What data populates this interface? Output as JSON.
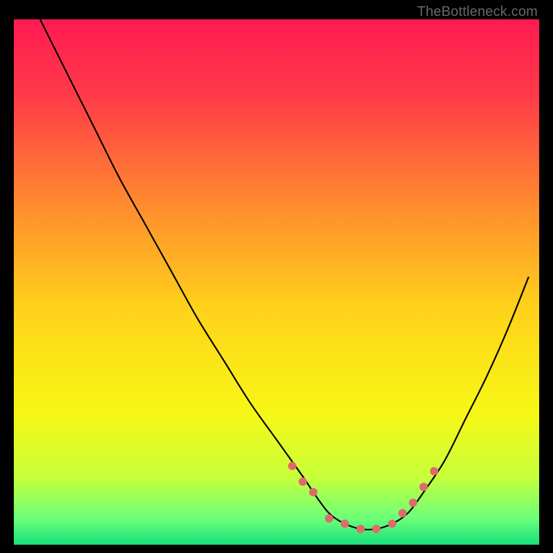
{
  "watermark": "TheBottleneck.com",
  "chart_data": {
    "type": "line",
    "title": "",
    "xlabel": "",
    "ylabel": "",
    "xlim": [
      0,
      100
    ],
    "ylim": [
      0,
      100
    ],
    "grid": false,
    "legend": false,
    "background_gradient": {
      "stops": [
        {
          "offset": 0.0,
          "color": "#ff1a52"
        },
        {
          "offset": 0.15,
          "color": "#ff3c48"
        },
        {
          "offset": 0.35,
          "color": "#ff8a2f"
        },
        {
          "offset": 0.55,
          "color": "#ffd21a"
        },
        {
          "offset": 0.75,
          "color": "#f7f716"
        },
        {
          "offset": 0.87,
          "color": "#c8ff3a"
        },
        {
          "offset": 0.95,
          "color": "#6cff7a"
        },
        {
          "offset": 1.0,
          "color": "#16e079"
        }
      ]
    },
    "series": [
      {
        "name": "bottleneck-curve",
        "color": "#000000",
        "x": [
          5,
          10,
          15,
          20,
          25,
          30,
          35,
          40,
          45,
          50,
          55,
          57,
          60,
          63,
          66,
          69,
          72,
          75,
          78,
          82,
          86,
          90,
          94,
          98
        ],
        "y": [
          100,
          90,
          80,
          70,
          61,
          52,
          43,
          35,
          27,
          20,
          13,
          10,
          6,
          4,
          3,
          3,
          4,
          6,
          10,
          16,
          24,
          32,
          41,
          51
        ]
      }
    ],
    "markers": {
      "name": "highlight-dots",
      "color": "#e06a6a",
      "radius": 6,
      "x": [
        53,
        55,
        57,
        60,
        63,
        66,
        69,
        72,
        74,
        76,
        78,
        80
      ],
      "y": [
        15,
        12,
        10,
        5,
        4,
        3,
        3,
        4,
        6,
        8,
        11,
        14
      ]
    }
  }
}
